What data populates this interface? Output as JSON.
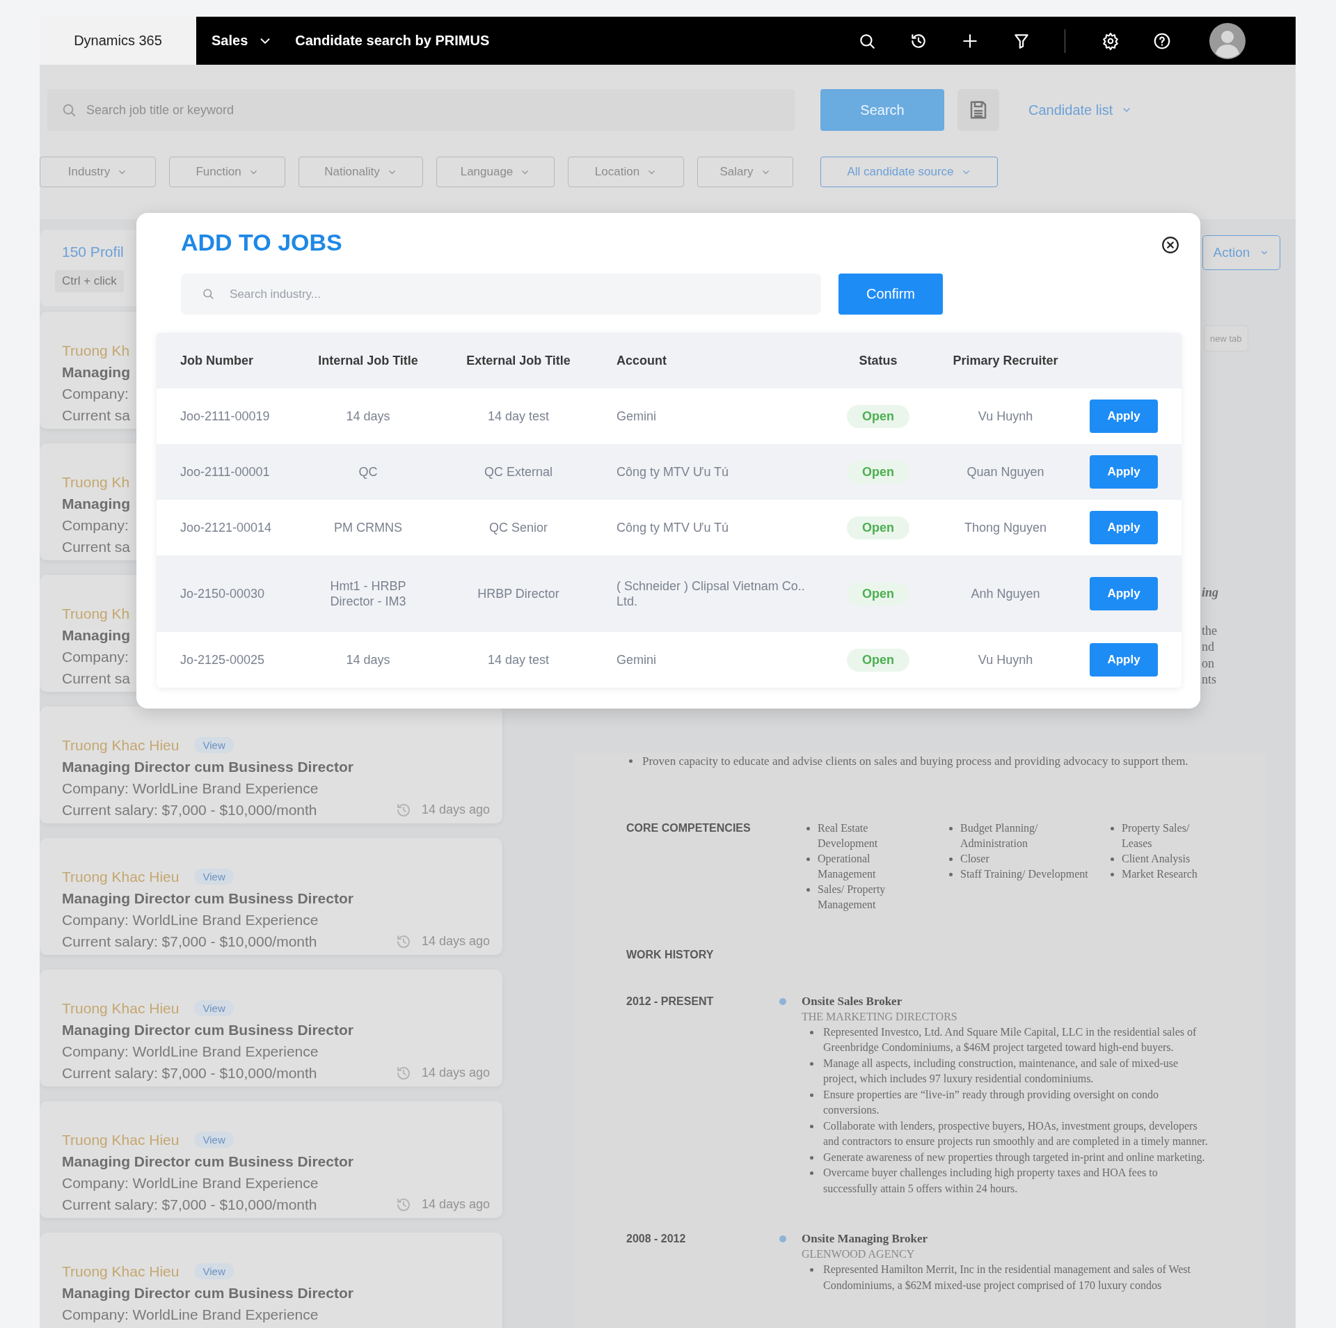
{
  "top_bar": {
    "brand": "Dynamics 365",
    "module": "Sales",
    "page_title": "Candidate search by PRIMUS"
  },
  "search": {
    "placeholder": "Search job title or keyword",
    "button": "Search",
    "candidate_list": "Candidate list"
  },
  "filters": [
    {
      "label": "Industry",
      "kind": "plain"
    },
    {
      "label": "Function",
      "kind": "plain"
    },
    {
      "label": "Nationality",
      "kind": "plain"
    },
    {
      "label": "Language",
      "kind": "plain"
    },
    {
      "label": "Location",
      "kind": "plain"
    },
    {
      "label": "Salary",
      "kind": "plain"
    },
    {
      "label": "All candidate source",
      "kind": "source"
    }
  ],
  "results": {
    "count": "150 Profil",
    "hint": "Ctrl + click"
  },
  "candidates": [
    {
      "name": "Truong Kh",
      "title": "Managing",
      "company": "Company:",
      "salary": "Current sa"
    },
    {
      "name": "Truong Kh",
      "title": "Managing",
      "company": "Company:",
      "salary": "Current sa"
    },
    {
      "name": "Truong Kh",
      "title": "Managing",
      "company": "Company:",
      "salary": "Current sa"
    },
    {
      "name": "Truong Khac Hieu",
      "view": "View",
      "title": "Managing Director cum Business Director",
      "company": "Company: WorldLine Brand Experience",
      "salary": "Current salary: $7,000 - $10,000/month",
      "age": "14 days ago"
    },
    {
      "name": "Truong Khac Hieu",
      "view": "View",
      "title": "Managing Director cum Business Director",
      "company": "Company: WorldLine Brand Experience",
      "salary": "Current salary: $7,000 - $10,000/month",
      "age": "14 days ago"
    },
    {
      "name": "Truong Khac Hieu",
      "view": "View",
      "title": "Managing Director cum Business Director",
      "company": "Company: WorldLine Brand Experience",
      "salary": "Current salary: $7,000 - $10,000/month",
      "age": "14 days ago"
    },
    {
      "name": "Truong Khac Hieu",
      "view": "View",
      "title": "Managing Director cum Business Director",
      "company": "Company: WorldLine Brand Experience",
      "salary": "Current salary: $7,000 - $10,000/month",
      "age": "14 days ago"
    },
    {
      "name": "Truong Khac Hieu",
      "view": "View",
      "title": "Managing Director cum Business Director",
      "company": "Company: WorldLine Brand Experience"
    }
  ],
  "detail": {
    "action": "Action",
    "new_tab": "new tab",
    "fragments": [
      {
        "text": "ing",
        "kind": "italic"
      },
      {
        "text": "the",
        "kind": "plain"
      },
      {
        "text": "nd",
        "kind": "plain"
      },
      {
        "text": "on",
        "kind": "plain"
      },
      {
        "text": "nts",
        "kind": "plain"
      }
    ],
    "intro_bullets": [
      "Proven capacity to educate and advise clients on sales and buying process and providing advocacy to support them."
    ],
    "competencies": {
      "heading": "CORE COMPETENCIES",
      "columns": [
        [
          "Real Estate Development",
          "Operational Management",
          "Sales/ Property Management"
        ],
        [
          "Budget Planning/ Administration",
          "Closer",
          "Staff Training/ Development"
        ],
        [
          "Property Sales/ Leases",
          "Client Analysis",
          "Market Research"
        ]
      ]
    },
    "work_history": {
      "heading": "WORK HISTORY",
      "entries": [
        {
          "period": "2012 - PRESENT",
          "role": "Onsite Sales Broker",
          "company": "THE MARKETING DIRECTORS",
          "bullets": [
            "Represented Investco, Ltd. And Square Mile Capital, LLC in the residential sales of Greenbridge Condominiums, a $46M project targeted toward high-end buyers.",
            "Manage all aspects, including construction, maintenance, and sale of mixed-use project, which includes 97 luxury residential condominiums.",
            "Ensure properties are “live-in” ready through providing oversight on condo conversions.",
            "Collaborate with lenders, prospective buyers, HOAs, investment groups, developers and contractors to ensure projects run smoothly and are completed in a timely manner.",
            "Generate awareness of new properties through targeted in-print and online marketing.",
            "Overcame buyer challenges including high property taxes and HOA fees to successfully attain 5 offers within 24 hours."
          ]
        },
        {
          "period": "2008 - 2012",
          "role": "Onsite Managing Broker",
          "company": "GLENWOOD AGENCY",
          "bullets": [
            "Represented Hamilton Merrit, Inc in the residential management and sales of West Condominiums, a $62M mixed-use project comprised of 170 luxury condos"
          ]
        }
      ]
    }
  },
  "dialog": {
    "title": "ADD TO JOBS",
    "search_placeholder": "Search industry...",
    "confirm": "Confirm",
    "columns": [
      "Job Number",
      "Internal Job Title",
      "External Job Title",
      "Account",
      "Status",
      "Primary Recruiter"
    ],
    "rows": [
      {
        "job_number": "Joo-2111-00019",
        "internal_title": "14 days",
        "external_title": "14 day test",
        "account": "Gemini",
        "status": "Open",
        "recruiter": "Vu Huynh",
        "action": "Apply"
      },
      {
        "job_number": "Joo-2111-00001",
        "internal_title": "QC",
        "external_title": "QC External",
        "account": "Công ty MTV Ưu Tú",
        "status": "Open",
        "recruiter": "Quan Nguyen",
        "action": "Apply"
      },
      {
        "job_number": "Joo-2121-00014",
        "internal_title": "PM CRMNS",
        "external_title": "QC Senior",
        "account": "Công ty MTV Ưu Tú",
        "status": "Open",
        "recruiter": "Thong Nguyen",
        "action": "Apply"
      },
      {
        "job_number": "Jo-2150-00030",
        "internal_title": "Hmt1 - HRBP Director - IM3",
        "external_title": "HRBP Director",
        "account": "( Schneider ) Clipsal Vietnam Co.. Ltd.",
        "status": "Open",
        "recruiter": "Anh Nguyen",
        "action": "Apply"
      },
      {
        "job_number": "Jo-2125-00025",
        "internal_title": "14 days",
        "external_title": "14 day test",
        "account": "Gemini",
        "status": "Open",
        "recruiter": "Vu Huynh",
        "action": "Apply"
      }
    ]
  }
}
